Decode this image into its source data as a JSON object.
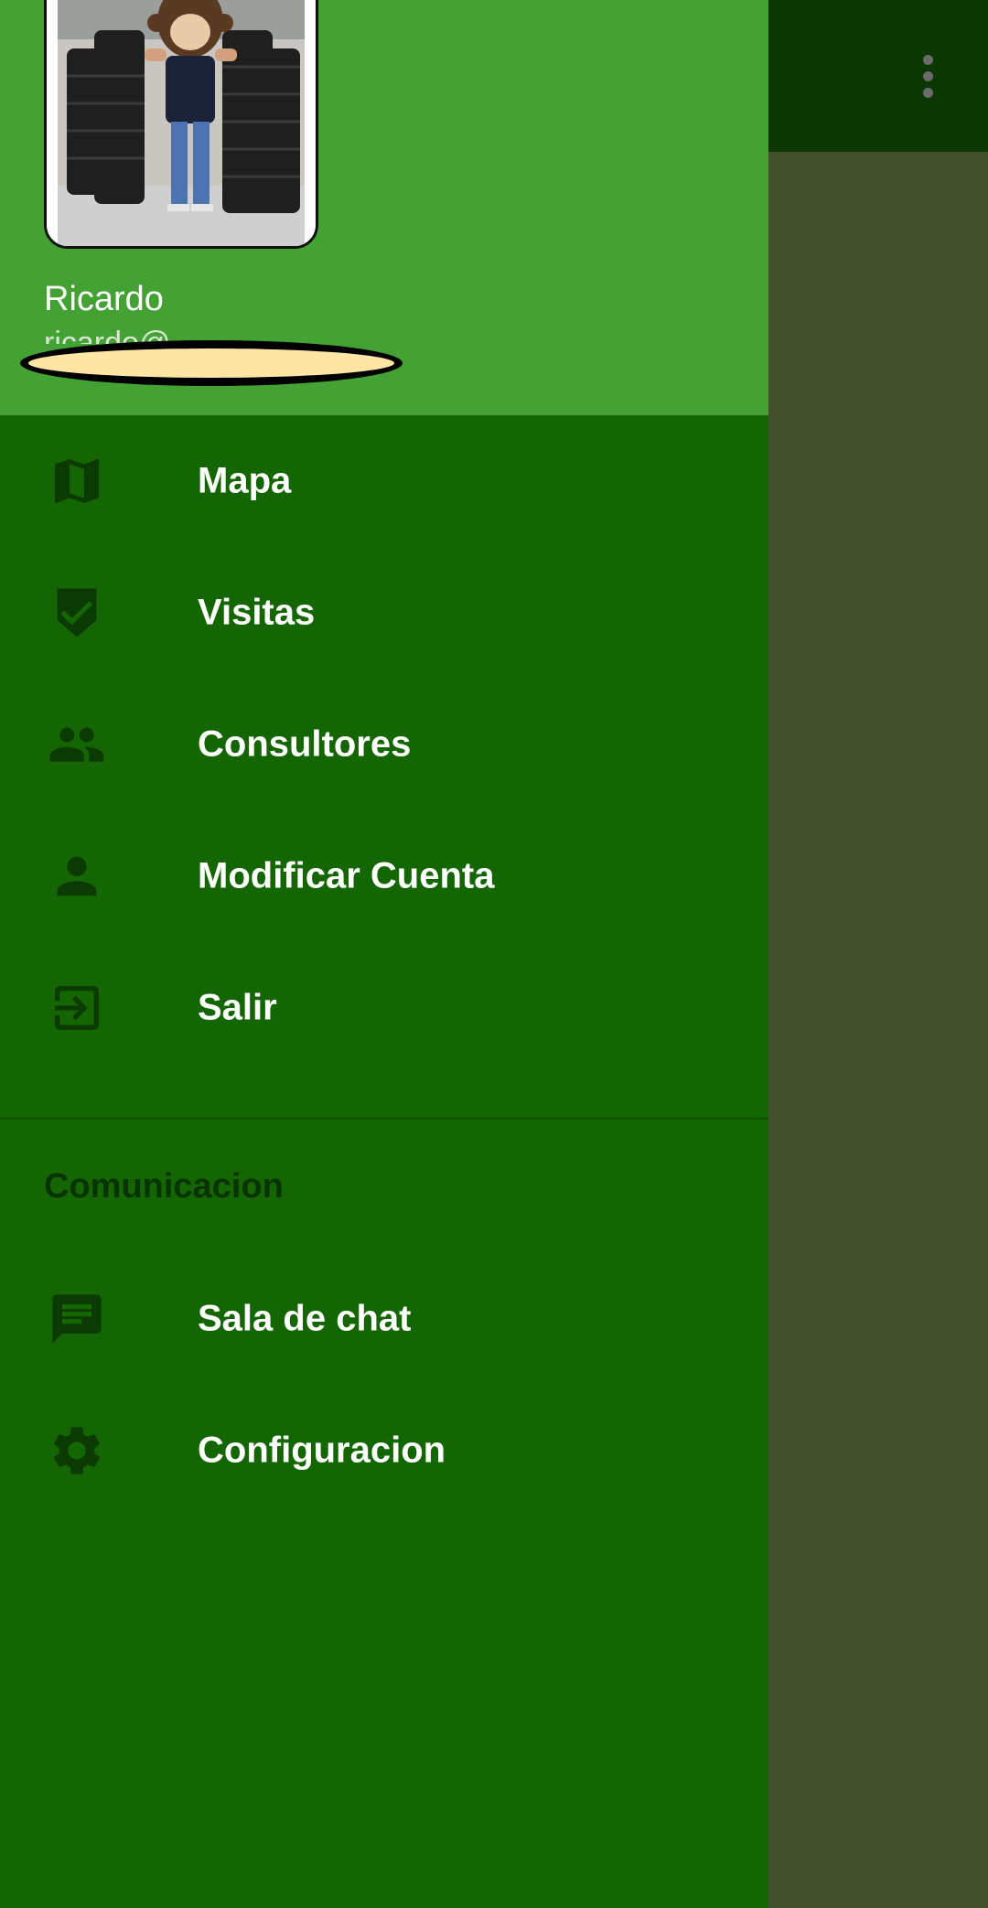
{
  "colors": {
    "drawer_bg": "#146602",
    "drawer_header_bg": "#44a133",
    "toolbar_bg": "#0b3802",
    "scrim_bg": "#41502a",
    "icon_color": "#0b3a02",
    "text_primary": "#ffffff",
    "section_header_color": "#093302"
  },
  "toolbar": {
    "overflow_icon": "more-vert-icon"
  },
  "header": {
    "user_name": "Ricardo",
    "user_email": "ricardo@..."
  },
  "menu": {
    "items": [
      {
        "label": "Mapa",
        "icon": "map-icon"
      },
      {
        "label": "Visitas",
        "icon": "verified-shield-icon"
      },
      {
        "label": "Consultores",
        "icon": "people-icon"
      },
      {
        "label": "Modificar Cuenta",
        "icon": "person-icon"
      },
      {
        "label": "Salir",
        "icon": "exit-icon"
      }
    ]
  },
  "communication": {
    "section_title": "Comunicacion",
    "items": [
      {
        "label": "Sala de chat",
        "icon": "chat-icon"
      },
      {
        "label": "Configuracion",
        "icon": "settings-gear-icon"
      }
    ]
  }
}
